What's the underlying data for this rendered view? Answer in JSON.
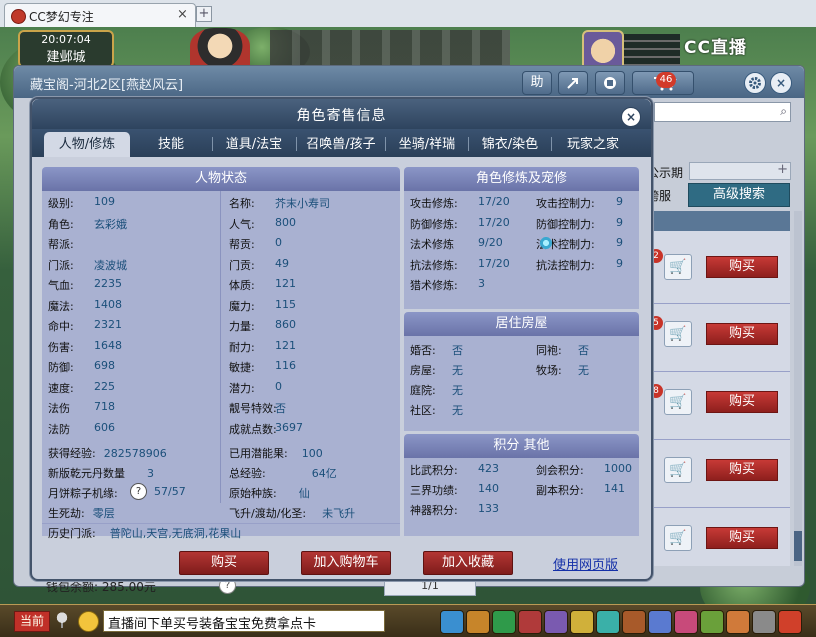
{
  "browser": {
    "tab_title": "CC梦幻专注",
    "tab_close": "×",
    "new_tab": "+"
  },
  "game": {
    "clock": "20:07:04",
    "location": "建邺城",
    "live_logo": "CC直播"
  },
  "outer_window": {
    "title": "藏宝阁-河北2区[燕赵风云]",
    "toolbar": {
      "help_label": "助",
      "notification_count": "46"
    },
    "public_period_label": "公示期",
    "cross_server_label": "跨服",
    "advanced_search_label": "高级搜索",
    "buy_label": "购买",
    "wallet_text": "钱包余额: 285.00元",
    "page_indicator": "1/1",
    "badge_digits": [
      "2",
      "5",
      "8"
    ]
  },
  "dialog": {
    "title": "角色寄售信息",
    "close": "×",
    "tabs": [
      "人物/修炼",
      "技能",
      "道具/法宝",
      "召唤兽/孩子",
      "坐骑/祥瑞",
      "锦衣/染色",
      "玩家之家"
    ],
    "active_tab": 0,
    "character_status": {
      "title": "人物状态",
      "left": [
        {
          "k": "级别:",
          "v": "109"
        },
        {
          "k": "角色:",
          "v": "玄彩娥"
        },
        {
          "k": "帮派:",
          "v": ""
        },
        {
          "k": "门派:",
          "v": "凌波城"
        },
        {
          "k": "气血:",
          "v": "2235"
        },
        {
          "k": "魔法:",
          "v": "1408"
        },
        {
          "k": "命中:",
          "v": "2321"
        },
        {
          "k": "伤害:",
          "v": "1648"
        },
        {
          "k": "防御:",
          "v": "698"
        },
        {
          "k": "速度:",
          "v": "225"
        },
        {
          "k": "法伤",
          "v": "718"
        },
        {
          "k": "法防",
          "v": "606"
        }
      ],
      "right": [
        {
          "k": "名称:",
          "v": "芥末小寿司"
        },
        {
          "k": "人气:",
          "v": "800"
        },
        {
          "k": "帮贡:",
          "v": "0"
        },
        {
          "k": "门贡:",
          "v": "49"
        },
        {
          "k": "体质:",
          "v": "121"
        },
        {
          "k": "魔力:",
          "v": "115"
        },
        {
          "k": "力量:",
          "v": "860"
        },
        {
          "k": "耐力:",
          "v": "121"
        },
        {
          "k": "敏捷:",
          "v": "116"
        },
        {
          "k": "潜力:",
          "v": "0"
        },
        {
          "k": "靓号特效:",
          "v": "否"
        },
        {
          "k": "成就点数:",
          "v": "3697"
        }
      ],
      "exp_label": "获得经验:",
      "exp_value": "282578906",
      "potential_fruit_label": "已用潜能果:",
      "potential_fruit_value": "100",
      "qianyuan_label": "新版乾元丹数量",
      "qianyuan_value": "3",
      "total_exp_label": "总经验:",
      "total_exp_value": "64亿",
      "mooncake_label": "月饼粽子机缘:",
      "mooncake_question": "?",
      "mooncake_value": "57/57",
      "original_race_label": "原始种族:",
      "original_race_value": "仙",
      "life_death_label": "生死劫:",
      "life_death_value": "零层",
      "ascension_label": "飞升/渡劫/化圣:",
      "ascension_value": "未飞升",
      "history_label": "历史门派:",
      "history_value": "普陀山,天宫,无底洞,花果山"
    },
    "cultivation": {
      "title": "角色修炼及宠修",
      "left": [
        {
          "k": "攻击修炼:",
          "v": "17/20"
        },
        {
          "k": "防御修炼:",
          "v": "17/20"
        },
        {
          "k": "法术修炼",
          "v": "9/20"
        },
        {
          "k": "抗法修炼:",
          "v": "17/20"
        },
        {
          "k": "猎术修炼:",
          "v": "3"
        }
      ],
      "right": [
        {
          "k": "攻击控制力:",
          "v": "9"
        },
        {
          "k": "防御控制力:",
          "v": "9"
        },
        {
          "k": "法术控制力:",
          "v": "9"
        },
        {
          "k": "抗法控制力:",
          "v": "9"
        }
      ]
    },
    "housing": {
      "title": "居住房屋",
      "left": [
        {
          "k": "婚否:",
          "v": "否"
        },
        {
          "k": "房屋:",
          "v": "无"
        },
        {
          "k": "庭院:",
          "v": "无"
        },
        {
          "k": "社区:",
          "v": "无"
        }
      ],
      "right": [
        {
          "k": "同袍:",
          "v": "否"
        },
        {
          "k": "牧场:",
          "v": "无"
        }
      ]
    },
    "points": {
      "title": "积分 其他",
      "left": [
        {
          "k": "比武积分:",
          "v": "423"
        },
        {
          "k": "三界功绩:",
          "v": "140"
        },
        {
          "k": "神器积分:",
          "v": "133"
        }
      ],
      "right": [
        {
          "k": "剑会积分:",
          "v": "1000"
        },
        {
          "k": "副本积分:",
          "v": "141"
        }
      ]
    },
    "buttons": {
      "buy": "购买",
      "add_cart": "加入购物车",
      "add_favorite": "加入收藏",
      "web_version": "使用网页版"
    }
  },
  "bottom_bar": {
    "channel": "当前",
    "chat_text": "直播间下单买号装备宝宝免费拿点卡"
  }
}
